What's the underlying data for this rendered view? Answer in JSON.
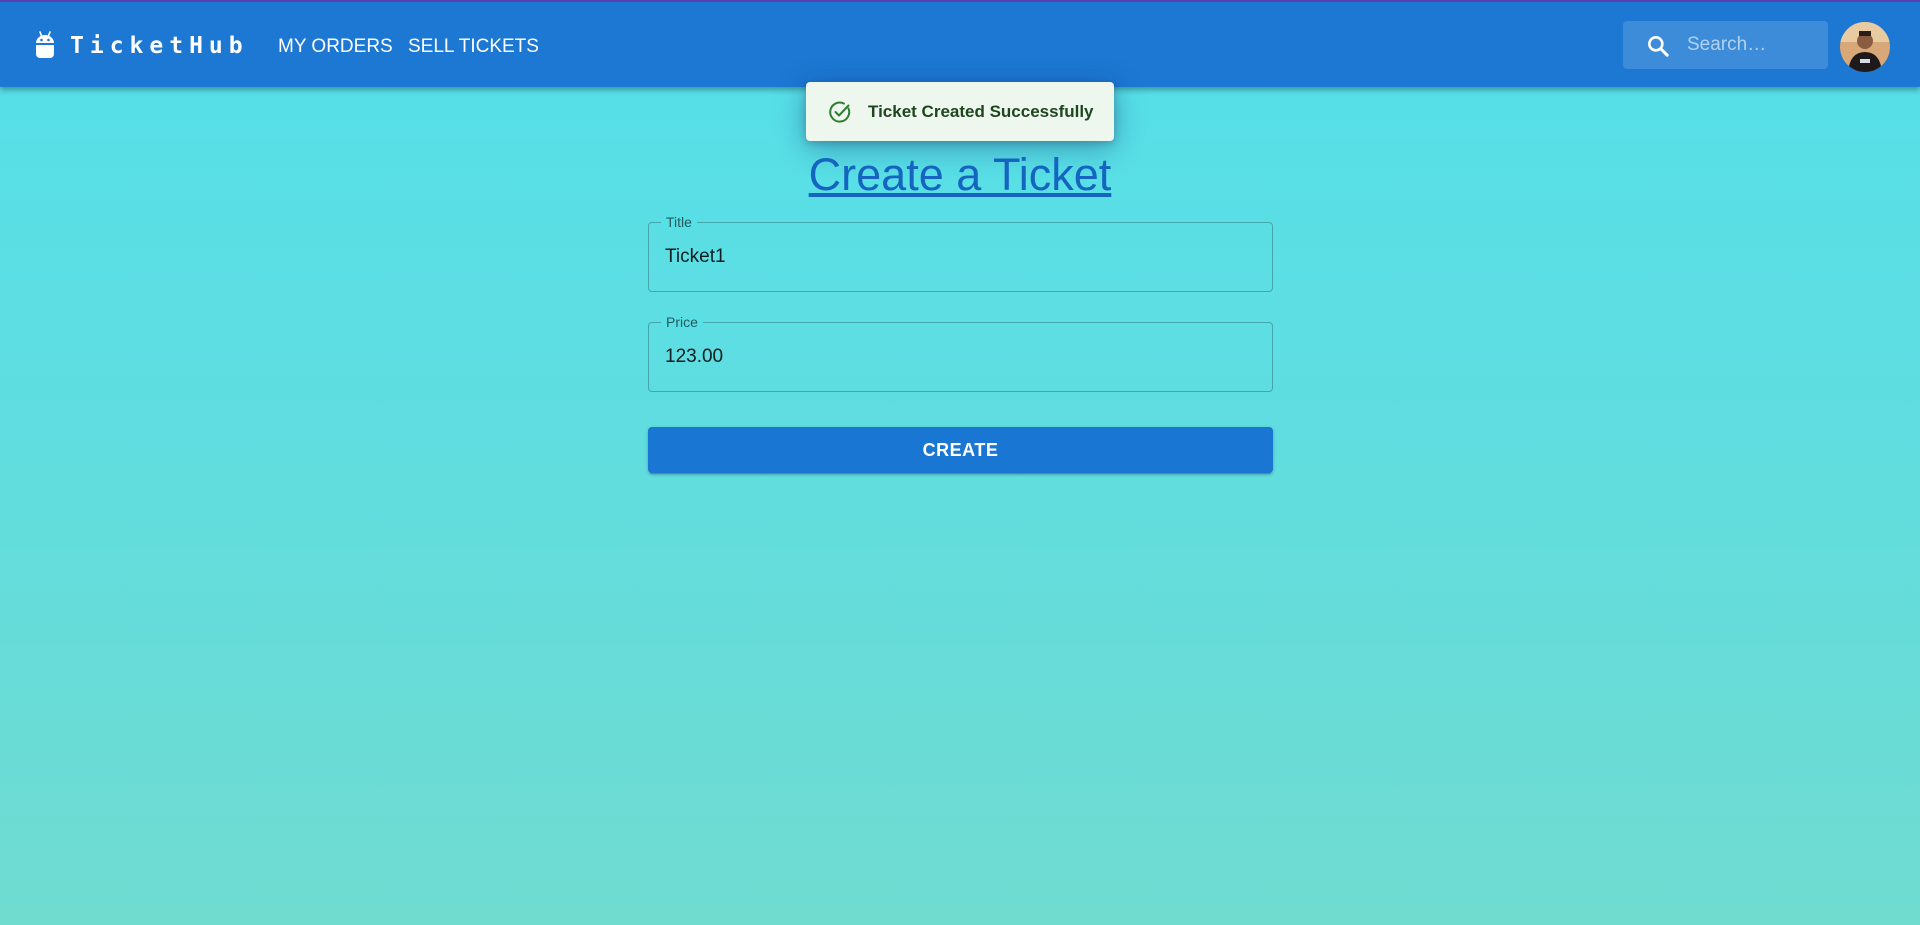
{
  "header": {
    "brand_icon": "android-icon",
    "brand_name": "TicketHub",
    "nav": {
      "my_orders": "MY ORDERS",
      "sell_tickets": "SELL TICKETS"
    },
    "search": {
      "icon": "search-icon",
      "placeholder": "Search…",
      "value": ""
    },
    "avatar": "user-avatar"
  },
  "toast": {
    "icon": "check-circle-icon",
    "message": "Ticket Created Successfully",
    "severity": "success"
  },
  "form": {
    "heading": "Create a Ticket",
    "title_field": {
      "label": "Title",
      "value": "Ticket1"
    },
    "price_field": {
      "label": "Price",
      "value": "123.00"
    },
    "submit_label": "CREATE"
  },
  "colors": {
    "appbar": "#1c78d3",
    "primary": "#1976d2",
    "heading": "#1565c0",
    "toast_bg": "#edf7ed",
    "toast_text": "#1e4620",
    "success_icon": "#2e7d32",
    "background_top": "#54e0ea",
    "background_bottom": "#70dcd0"
  }
}
